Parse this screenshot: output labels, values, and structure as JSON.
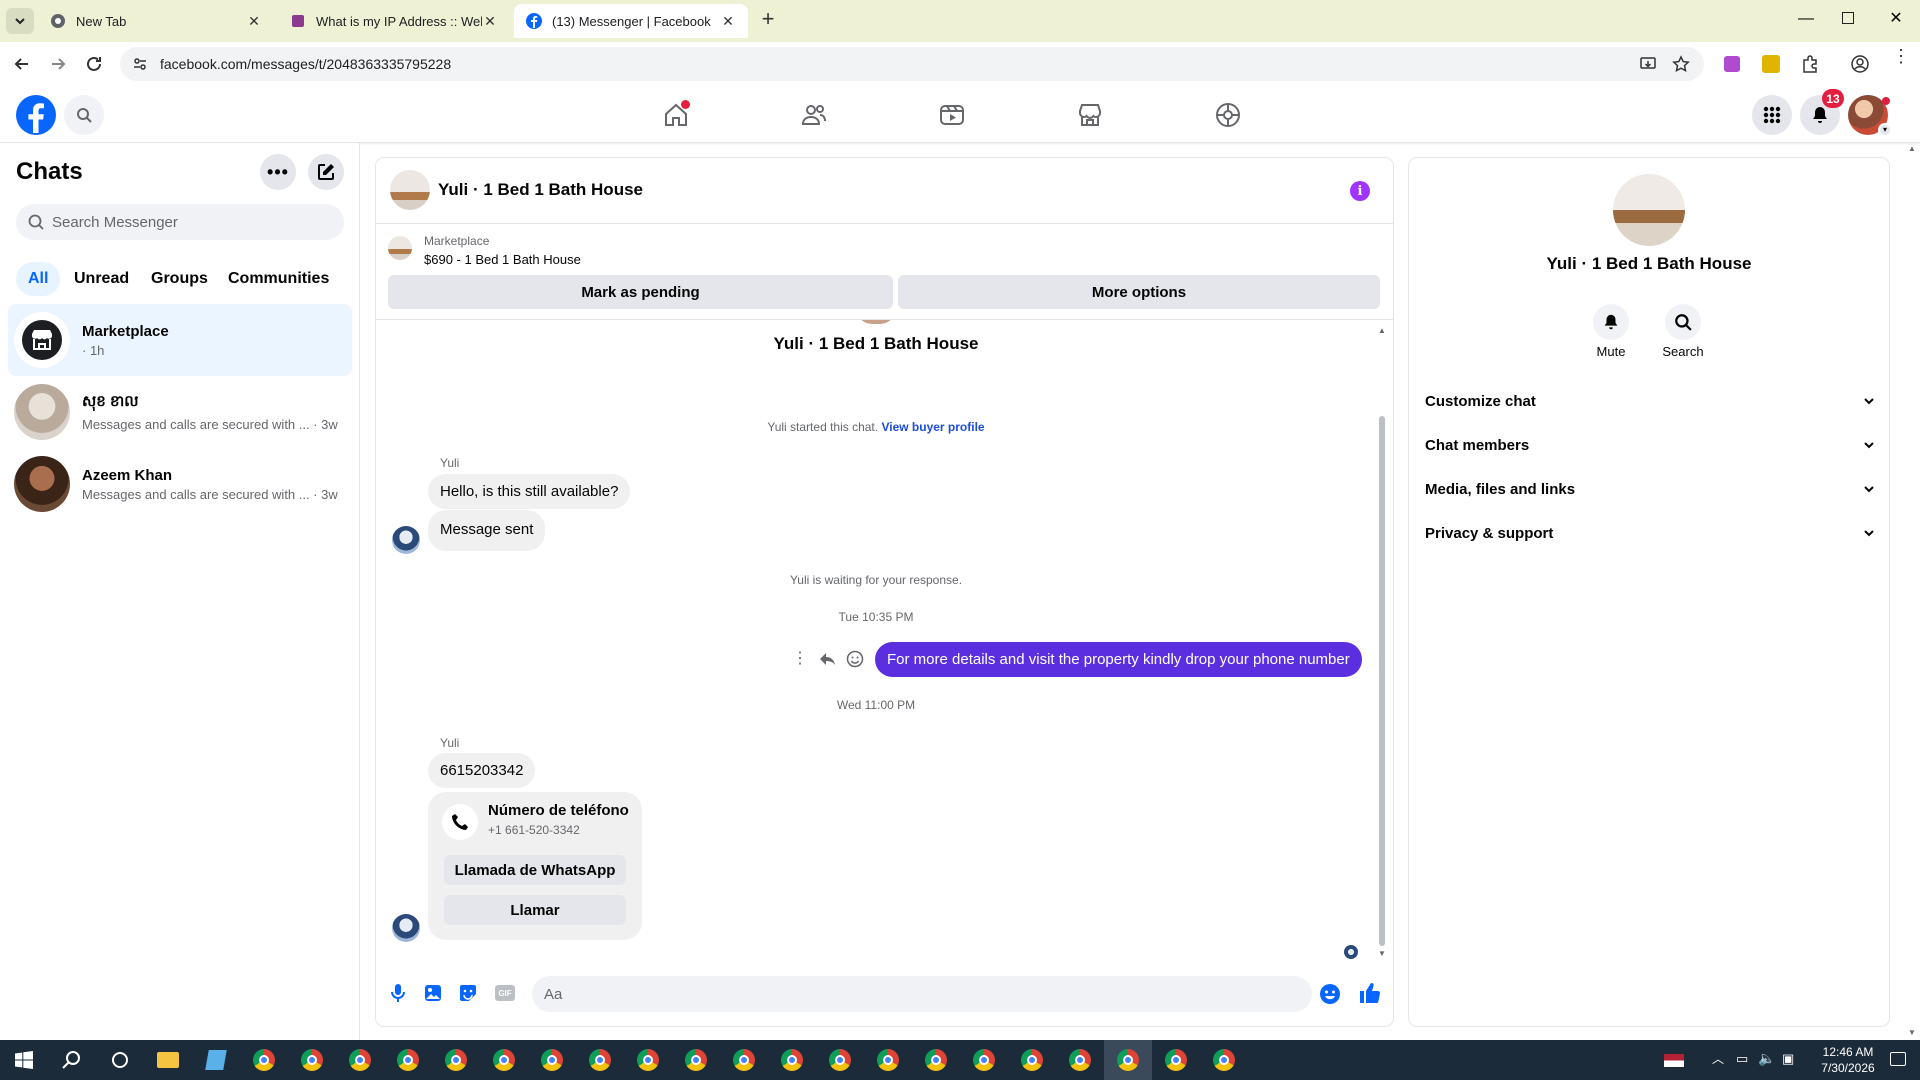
{
  "browser": {
    "tabs": [
      {
        "title": "New Tab",
        "active": false
      },
      {
        "title": "What is my IP Address :: WebBr",
        "active": false
      },
      {
        "title": "(13) Messenger | Facebook",
        "active": true
      }
    ],
    "url": "facebook.com/messages/t/2048363335795228"
  },
  "fb": {
    "notifications_count": "13"
  },
  "sidebar": {
    "title": "Chats",
    "search_placeholder": "Search Messenger",
    "filters": [
      "All",
      "Unread",
      "Groups",
      "Communities"
    ],
    "chats": [
      {
        "name": "Marketplace",
        "preview": "· 1h",
        "selected": true
      },
      {
        "name": "សុខ ខាល",
        "preview": "Messages and calls are secured with ...",
        "time": "· 3w"
      },
      {
        "name": "Azeem Khan",
        "preview": "Messages and calls are secured with ...",
        "time": "· 3w"
      }
    ]
  },
  "conversation": {
    "title": "Yuli · 1 Bed 1 Bath House",
    "marketplace_label": "Marketplace",
    "listing": "$690 - 1 Bed 1 Bath House",
    "mark_pending": "Mark as pending",
    "more_options": "More options",
    "header_name": "Yuli · 1 Bed 1 Bath House",
    "started_text": "Yuli started this chat.",
    "view_profile": "View buyer profile",
    "sender": "Yuli",
    "msg1": "Hello, is this still available?",
    "msg2": "Message sent",
    "waiting": "Yuli is waiting for your response.",
    "ts1": "Tue 10:35 PM",
    "outgoing": "For more details and visit the property kindly drop your phone number",
    "ts2": "Wed 11:00 PM",
    "sender2": "Yuli",
    "phone_msg": "6615203342",
    "card_title": "Número de teléfono",
    "card_phone": "+1 661-520-3342",
    "card_btn1": "Llamada de WhatsApp",
    "card_btn2": "Llamar",
    "composer_placeholder": "Aa"
  },
  "details": {
    "name": "Yuli · 1 Bed 1 Bath House",
    "mute": "Mute",
    "search": "Search",
    "sections": [
      "Customize chat",
      "Chat members",
      "Media, files and links",
      "Privacy & support"
    ]
  },
  "taskbar": {
    "time": "12:46 AM",
    "date": "7/30/2026"
  },
  "colors": {
    "accent": "#0866ff",
    "outgoing_bubble": "#5b2fe0",
    "info_icon": "#a033ff"
  }
}
